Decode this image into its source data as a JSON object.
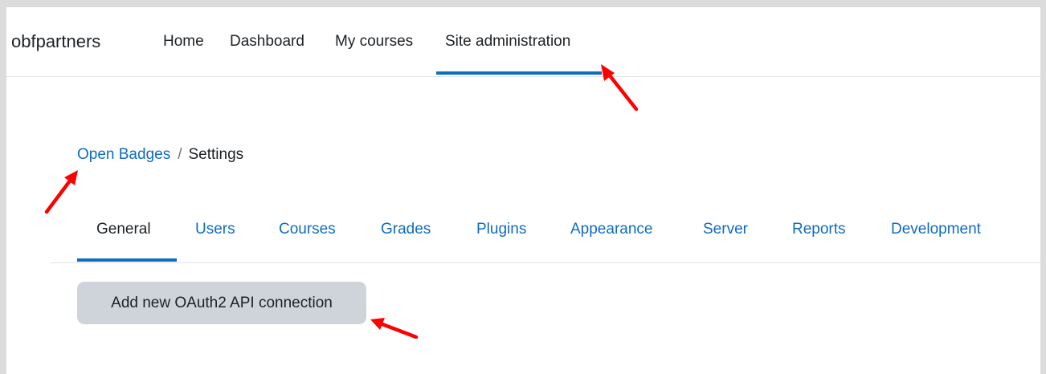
{
  "header": {
    "brand": "obfpartners",
    "nav": [
      {
        "label": "Home"
      },
      {
        "label": "Dashboard"
      },
      {
        "label": "My courses"
      },
      {
        "label": "Site administration",
        "active": true
      }
    ]
  },
  "breadcrumb": {
    "link": "Open Badges",
    "separator": "/",
    "current": "Settings"
  },
  "tabs": [
    {
      "label": "General",
      "active": true
    },
    {
      "label": "Users"
    },
    {
      "label": "Courses"
    },
    {
      "label": "Grades"
    },
    {
      "label": "Plugins"
    },
    {
      "label": "Appearance"
    },
    {
      "label": "Server"
    },
    {
      "label": "Reports"
    },
    {
      "label": "Development"
    }
  ],
  "main": {
    "add_connection_label": "Add new OAuth2 API connection"
  },
  "colors": {
    "accent": "#0f6cbf",
    "text": "#1d2125",
    "button_bg": "#ced4da",
    "annotation_arrow": "#ff0000"
  }
}
